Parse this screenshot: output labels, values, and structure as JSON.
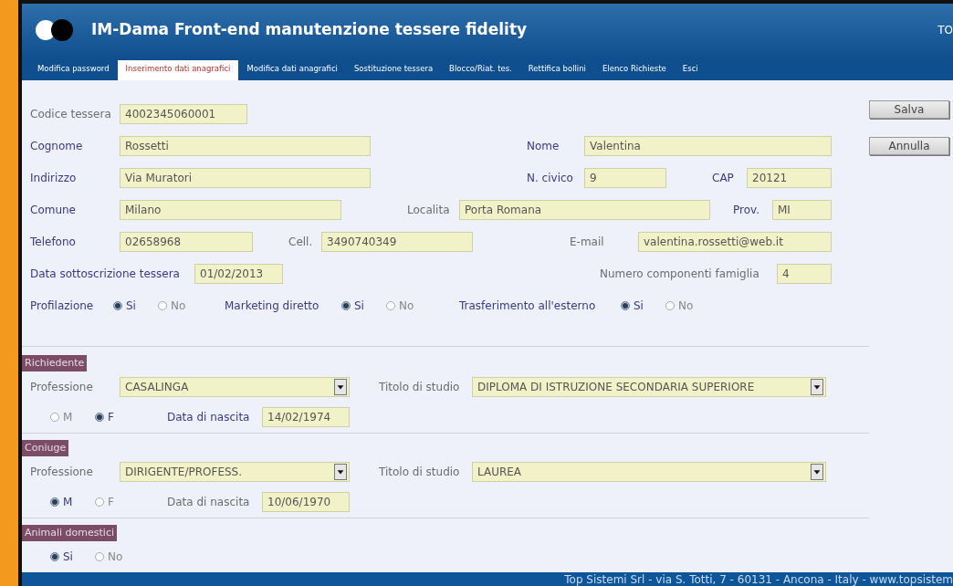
{
  "app": {
    "title": "IM-Dama Front-end manutenzione tessere fidelity",
    "corner_text": "TO"
  },
  "tabs": [
    {
      "label": "Modifica password",
      "selected": false
    },
    {
      "label": "Inserimento dati anagrafici",
      "selected": true
    },
    {
      "label": "Modifica dati anagrafici",
      "selected": false
    },
    {
      "label": "Sostituzione tessera",
      "selected": false
    },
    {
      "label": "Blocco/Riat. tes.",
      "selected": false
    },
    {
      "label": "Rettifica bollini",
      "selected": false
    },
    {
      "label": "Elenco Richieste",
      "selected": false
    },
    {
      "label": "Esci",
      "selected": false
    }
  ],
  "form": {
    "rows": [
      [
        {
          "kind": "text",
          "label": "Codice tessera",
          "highlighted": false,
          "value": "4002345060001"
        }
      ],
      [
        {
          "kind": "text",
          "label": "Cognome",
          "highlighted": true,
          "value": "Rossetti"
        },
        {
          "kind": "text",
          "label": "Nome",
          "highlighted": true,
          "value": "Valentina"
        }
      ],
      [
        {
          "kind": "text",
          "label": "Indirizzo",
          "highlighted": true,
          "value": "Via Muratori"
        },
        {
          "kind": "text",
          "label": "N. civico",
          "highlighted": true,
          "value": "9"
        },
        {
          "kind": "text",
          "label": "CAP",
          "highlighted": true,
          "value": "20121"
        }
      ],
      [
        {
          "kind": "text",
          "label": "Comune",
          "highlighted": true,
          "value": "Milano"
        },
        {
          "kind": "text",
          "label": "Localita",
          "highlighted": false,
          "value": "Porta Romana"
        },
        {
          "kind": "text",
          "label": "Prov.",
          "highlighted": true,
          "value": "MI"
        }
      ],
      [
        {
          "kind": "text",
          "label": "Telefono",
          "highlighted": true,
          "value": "02658968"
        },
        {
          "kind": "text",
          "label": "Cell.",
          "highlighted": false,
          "value": "3490740349"
        },
        {
          "kind": "text",
          "label": "E-mail",
          "highlighted": false,
          "value": "valentina.rossetti@web.it"
        }
      ],
      [
        {
          "kind": "text",
          "label": "Data sottoscrizione tessera",
          "highlighted": true,
          "value": "01/02/2013"
        },
        {
          "kind": "text",
          "label": "Numero componenti famiglia",
          "highlighted": false,
          "value": "4"
        }
      ],
      [
        {
          "kind": "radio",
          "label": "Profilazione",
          "highlighted": true,
          "options": [
            {
              "label": "Si",
              "selected": true
            },
            {
              "label": "No",
              "selected": false
            }
          ]
        },
        {
          "kind": "radio",
          "label": "Marketing diretto",
          "highlighted": true,
          "options": [
            {
              "label": "Si",
              "selected": true
            },
            {
              "label": "No",
              "selected": false
            }
          ]
        },
        {
          "kind": "radio",
          "label": "Trasferimento all'esterno",
          "highlighted": true,
          "options": [
            {
              "label": "Si",
              "selected": true
            },
            {
              "label": "No",
              "selected": false
            }
          ]
        }
      ]
    ]
  },
  "buttons": [
    "Salva",
    "Annulla"
  ],
  "sections": [
    {
      "title": "Richiedente",
      "rows": [
        [
          {
            "kind": "select",
            "label": "Professione",
            "highlighted": false,
            "value": "CASALINGA"
          },
          {
            "kind": "select",
            "label": "Titolo di studio",
            "highlighted": false,
            "value": "DIPLOMA DI ISTRUZIONE SECONDARIA SUPERIORE"
          }
        ],
        [
          {
            "kind": "radio",
            "options": [
              {
                "label": "M",
                "selected": false
              },
              {
                "label": "F",
                "selected": true
              }
            ]
          },
          {
            "kind": "text",
            "label": "Data di nascita",
            "highlighted": true,
            "value": "14/02/1974"
          }
        ]
      ]
    },
    {
      "title": "Coniuge",
      "rows": [
        [
          {
            "kind": "select",
            "label": "Professione",
            "highlighted": false,
            "value": "DIRIGENTE/PROFESS."
          },
          {
            "kind": "select",
            "label": "Titolo di studio",
            "highlighted": false,
            "value": "LAUREA"
          }
        ],
        [
          {
            "kind": "radio",
            "options": [
              {
                "label": "M",
                "selected": true
              },
              {
                "label": "F",
                "selected": false
              }
            ]
          },
          {
            "kind": "text",
            "label": "Data di nascita",
            "highlighted": false,
            "value": "10/06/1970"
          }
        ]
      ]
    },
    {
      "title": "Animali domestici",
      "rows": [
        [
          {
            "kind": "radio",
            "options": [
              {
                "label": "Si",
                "selected": true
              },
              {
                "label": "No",
                "selected": false
              }
            ]
          }
        ]
      ]
    }
  ],
  "footer": "Top Sistemi Srl - via S. Totti, 7 - 60131 - Ancona - Italy - www.topsistem"
}
